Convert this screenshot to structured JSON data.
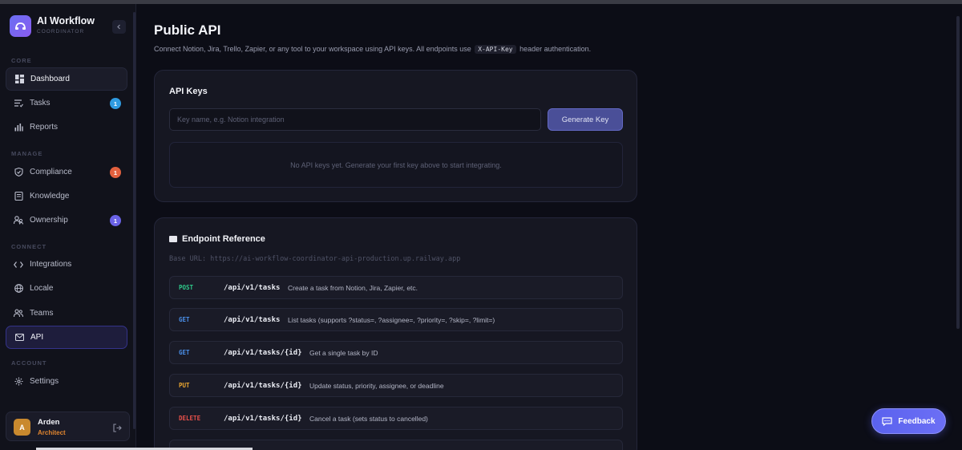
{
  "brand": {
    "title": "AI Workflow",
    "subtitle": "COORDINATOR"
  },
  "sidebar": {
    "sections": {
      "core": "CORE",
      "manage": "MANAGE",
      "connect": "CONNECT",
      "account": "ACCOUNT"
    },
    "items": {
      "dashboard": "Dashboard",
      "tasks": "Tasks",
      "reports": "Reports",
      "compliance": "Compliance",
      "knowledge": "Knowledge",
      "ownership": "Ownership",
      "integrations": "Integrations",
      "locale": "Locale",
      "teams": "Teams",
      "api": "API",
      "settings": "Settings"
    },
    "badges": {
      "tasks": "1",
      "compliance": "1",
      "ownership": "1"
    },
    "badge_colors": {
      "tasks": "#2f9be0",
      "compliance": "#e2603e",
      "ownership": "#6a62e6"
    }
  },
  "user": {
    "initial": "A",
    "name": "Arden",
    "role": "Architect"
  },
  "page": {
    "title": "Public API",
    "subtitle_pre": "Connect Notion, Jira, Trello, Zapier, or any tool to your workspace using API keys. All endpoints use",
    "subtitle_code": "X-API-Key",
    "subtitle_post": "header authentication."
  },
  "api_keys": {
    "title": "API Keys",
    "input_placeholder": "Key name, e.g. Notion integration",
    "generate_label": "Generate Key",
    "empty_text": "No API keys yet. Generate your first key above to start integrating."
  },
  "endpoints": {
    "title": "Endpoint Reference",
    "base_url": "Base URL: https://ai-workflow-coordinator-api-production.up.railway.app",
    "items": [
      {
        "method": "POST",
        "path": "/api/v1/tasks",
        "desc": "Create a task from Notion, Jira, Zapier, etc.",
        "color": "#2ec98a"
      },
      {
        "method": "GET",
        "path": "/api/v1/tasks",
        "desc": "List tasks (supports ?status=, ?assignee=, ?priority=, ?skip=, ?limit=)",
        "color": "#4a8fe8"
      },
      {
        "method": "GET",
        "path": "/api/v1/tasks/{id}",
        "desc": "Get a single task by ID",
        "color": "#4a8fe8"
      },
      {
        "method": "PUT",
        "path": "/api/v1/tasks/{id}",
        "desc": "Update status, priority, assignee, or deadline",
        "color": "#e8a531"
      },
      {
        "method": "DELETE",
        "path": "/api/v1/tasks/{id}",
        "desc": "Cancel a task (sets status to cancelled)",
        "color": "#e8504a"
      }
    ]
  },
  "feedback": {
    "label": "Feedback"
  }
}
